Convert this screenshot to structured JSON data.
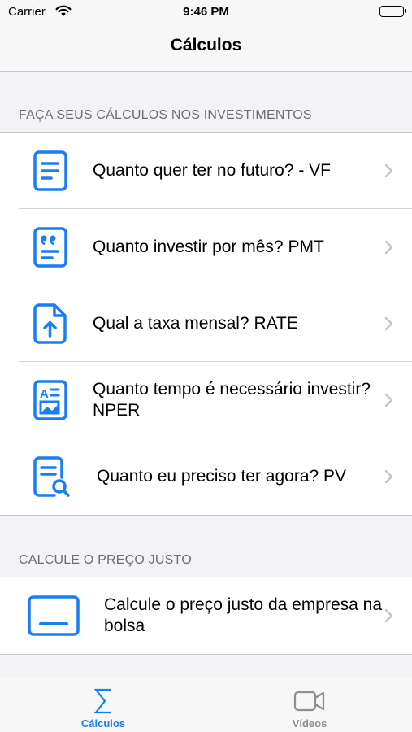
{
  "status_bar": {
    "carrier": "Carrier",
    "time": "9:46 PM"
  },
  "nav": {
    "title": "Cálculos"
  },
  "sections": [
    {
      "header": "FAÇA SEUS CÁLCULOS NOS INVESTIMENTOS",
      "rows": [
        {
          "icon": "document-icon",
          "label": "Quanto quer ter no futuro? - VF"
        },
        {
          "icon": "quote-document-icon",
          "label": "Quanto investir por mês? PMT"
        },
        {
          "icon": "file-upload-icon",
          "label": "Qual a taxa mensal? RATE"
        },
        {
          "icon": "image-text-document-icon",
          "label": "Quanto tempo é necessário investir? NPER"
        },
        {
          "icon": "document-search-icon",
          "label": "Quanto eu preciso ter agora? PV"
        }
      ]
    },
    {
      "header": "CALCULE O PREÇO JUSTO",
      "rows": [
        {
          "icon": "screen-icon",
          "label": "Calcule o preço justo da empresa na bolsa"
        }
      ]
    }
  ],
  "tabs": [
    {
      "icon": "sigma-icon",
      "label": "Cálculos",
      "active": true
    },
    {
      "icon": "video-camera-icon",
      "label": "Vídeos",
      "active": false
    }
  ],
  "colors": {
    "accent": "#1a7ef0",
    "inactive": "#8e8e93"
  }
}
